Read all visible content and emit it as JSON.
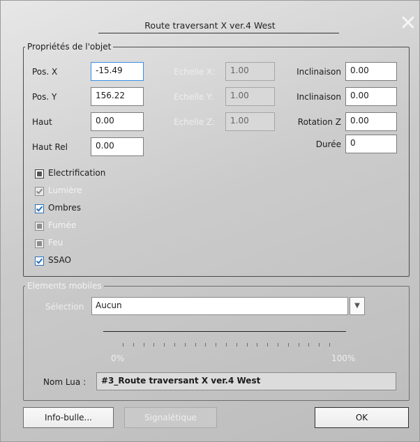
{
  "window": {
    "title": "Route traversant X ver.4 West",
    "close_glyph": "✕"
  },
  "properties": {
    "legend": "Propriétés de l'objet",
    "pos_x": {
      "label": "Pos. X",
      "value": "-15.49"
    },
    "pos_y": {
      "label": "Pos. Y",
      "value": "156.22"
    },
    "haut": {
      "label": "Haut",
      "value": "0.00"
    },
    "haut_rel": {
      "label": "Haut Rel",
      "value": "0.00"
    },
    "scale_x": {
      "label": "Echelle X:",
      "value": "1.00"
    },
    "scale_y": {
      "label": "Echelle Y:",
      "value": "1.00"
    },
    "scale_z": {
      "label": "Echelle Z:",
      "value": "1.00"
    },
    "incl_1": {
      "label": "Inclinaison",
      "value": "0.00"
    },
    "incl_2": {
      "label": "Inclinaison",
      "value": "0.00"
    },
    "rot_z": {
      "label": "Rotation Z",
      "value": "0.00"
    },
    "duree": {
      "label": "Durée",
      "value": "0"
    },
    "checkboxes": [
      {
        "label": "Electrification",
        "state": "indeterminate",
        "enabled": true
      },
      {
        "label": "Lumière",
        "state": "checked",
        "enabled": false
      },
      {
        "label": "Ombres",
        "state": "checked",
        "enabled": true
      },
      {
        "label": "Fumée",
        "state": "indeterminate",
        "enabled": false
      },
      {
        "label": "Feu",
        "state": "indeterminate",
        "enabled": false
      },
      {
        "label": "SSAO",
        "state": "checked",
        "enabled": true
      }
    ]
  },
  "moving": {
    "legend": "Elements mobiles",
    "selection_label": "Sélection",
    "selection_value": "Aucun",
    "slider_min": "0%",
    "slider_max": "100%",
    "slider_value": 0,
    "lua_label": "Nom Lua :",
    "lua_value": "#3_Route traversant X ver.4 West"
  },
  "buttons": {
    "info": "Info-bulle...",
    "signal": "Signalétique",
    "ok": "OK"
  },
  "colors": {
    "accent": "#3a8ee6",
    "check": "#2c6fb5",
    "panel": "#c4c4c4"
  }
}
